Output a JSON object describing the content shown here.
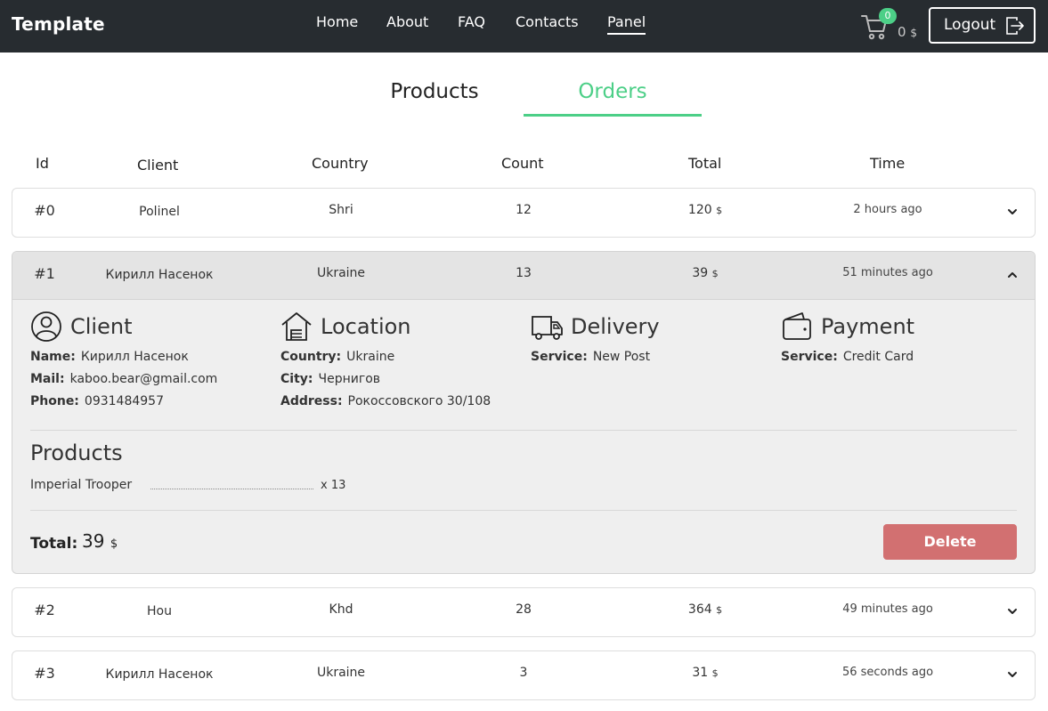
{
  "header": {
    "brand": "Template",
    "nav": [
      "Home",
      "About",
      "FAQ",
      "Contacts",
      "Panel"
    ],
    "active_nav": "Panel",
    "cart_count": "0",
    "cart_total": "0",
    "cart_currency": "$",
    "logout_label": "Logout"
  },
  "tabs": {
    "products": "Products",
    "orders": "Orders",
    "active": "Orders"
  },
  "table": {
    "columns": {
      "id": "Id",
      "client": "Client",
      "country": "Country",
      "count": "Count",
      "total": "Total",
      "time": "Time"
    },
    "currency": "$",
    "rows": [
      {
        "id": "#0",
        "client": "Polinel",
        "country": "Shri",
        "count": "12",
        "total": "120",
        "time": "2 hours ago"
      },
      {
        "id": "#1",
        "client": "Кирилл Насенок",
        "country": "Ukraine",
        "count": "13",
        "total": "39",
        "time": "51 minutes ago"
      },
      {
        "id": "#2",
        "client": "Hou",
        "country": "Khd",
        "count": "28",
        "total": "364",
        "time": "49 minutes ago"
      },
      {
        "id": "#3",
        "client": "Кирилл Насенок",
        "country": "Ukraine",
        "count": "3",
        "total": "31",
        "time": "56 seconds ago"
      }
    ]
  },
  "detail": {
    "client": {
      "title": "Client",
      "name_label": "Name:",
      "name": "Кирилл Насенок",
      "mail_label": "Mail:",
      "mail": "kaboo.bear@gmail.com",
      "phone_label": "Phone:",
      "phone": "0931484957"
    },
    "location": {
      "title": "Location",
      "country_label": "Country:",
      "country": "Ukraine",
      "city_label": "City:",
      "city": "Чернигов",
      "address_label": "Address:",
      "address": "Рокоссовского 30/108"
    },
    "delivery": {
      "title": "Delivery",
      "service_label": "Service:",
      "service": "New Post"
    },
    "payment": {
      "title": "Payment",
      "service_label": "Service:",
      "service": "Credit Card"
    },
    "products_title": "Products",
    "products": [
      {
        "name": "Imperial Trooper",
        "qty": "x 13"
      }
    ],
    "total_label": "Total:",
    "total": "39",
    "currency": "$",
    "delete_label": "Delete"
  },
  "colors": {
    "header_bg": "#272c30",
    "accent": "#4ccf87",
    "delete": "#d27071"
  },
  "icons": [
    "cart-icon",
    "logout-icon",
    "chevron-down-icon",
    "chevron-up-icon",
    "user-icon",
    "house-icon",
    "truck-icon",
    "wallet-icon"
  ]
}
